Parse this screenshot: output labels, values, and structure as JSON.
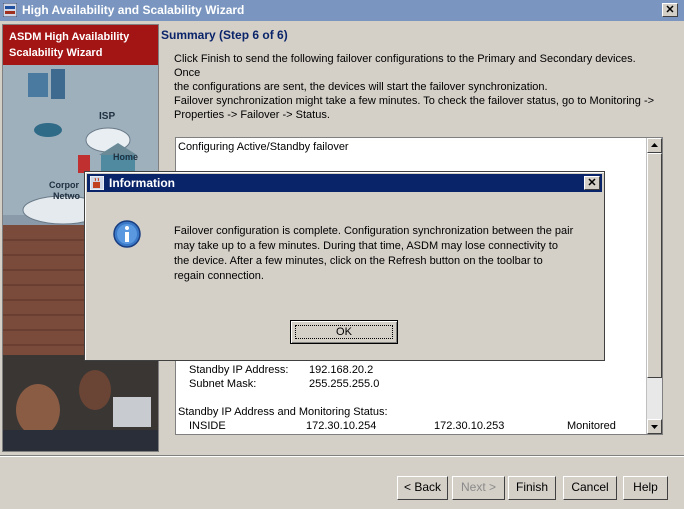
{
  "window": {
    "title": "High Availability and Scalability Wizard",
    "close_glyph": "✕"
  },
  "sidebar": {
    "banner_line1": "ASDM High Availability",
    "banner_line2": "Scalability Wizard",
    "isp_label": "ISP",
    "home_label": "Home",
    "corporate_label_line1": "Corpor",
    "corporate_label_line2": "Netwo"
  },
  "page": {
    "heading": "Summary (Step 6 of 6)",
    "intro_line1": "Click Finish to send the following failover configurations to the Primary and Secondary devices. Once",
    "intro_line2": "the configurations are sent, the devices will start the failover synchronization.",
    "intro_line3": "Failover synchronization might take a few minutes. To check the failover status, go to Monitoring ->",
    "intro_line4": "Properties -> Failover -> Status."
  },
  "summary": {
    "header": "Configuring Active/Standby failover",
    "standby_ip_label": "Standby IP Address:",
    "standby_ip_value": "192.168.20.2",
    "subnet_label": "Subnet Mask:",
    "subnet_value": "255.255.255.0",
    "monitoring_header": "Standby IP Address and Monitoring Status:",
    "row": {
      "interface": "INSIDE",
      "ip1": "172.30.10.254",
      "ip2": "172.30.10.253",
      "status": "Monitored"
    }
  },
  "buttons": {
    "back": "< Back",
    "next": "Next >",
    "finish": "Finish",
    "cancel": "Cancel",
    "help": "Help"
  },
  "dialog": {
    "title": "Information",
    "close_glyph": "✕",
    "message_line1": "Failover configuration is complete. Configuration synchronization between the pair",
    "message_line2": "may take up to a few minutes. During that time, ASDM may lose connectivity to",
    "message_line3": "the device. After a few minutes, click on the Refresh button on the toolbar to",
    "message_line4": "regain connection.",
    "ok": "OK"
  },
  "icons": {
    "window_icon": "asdm-app-icon",
    "dialog_icon": "info-icon"
  }
}
